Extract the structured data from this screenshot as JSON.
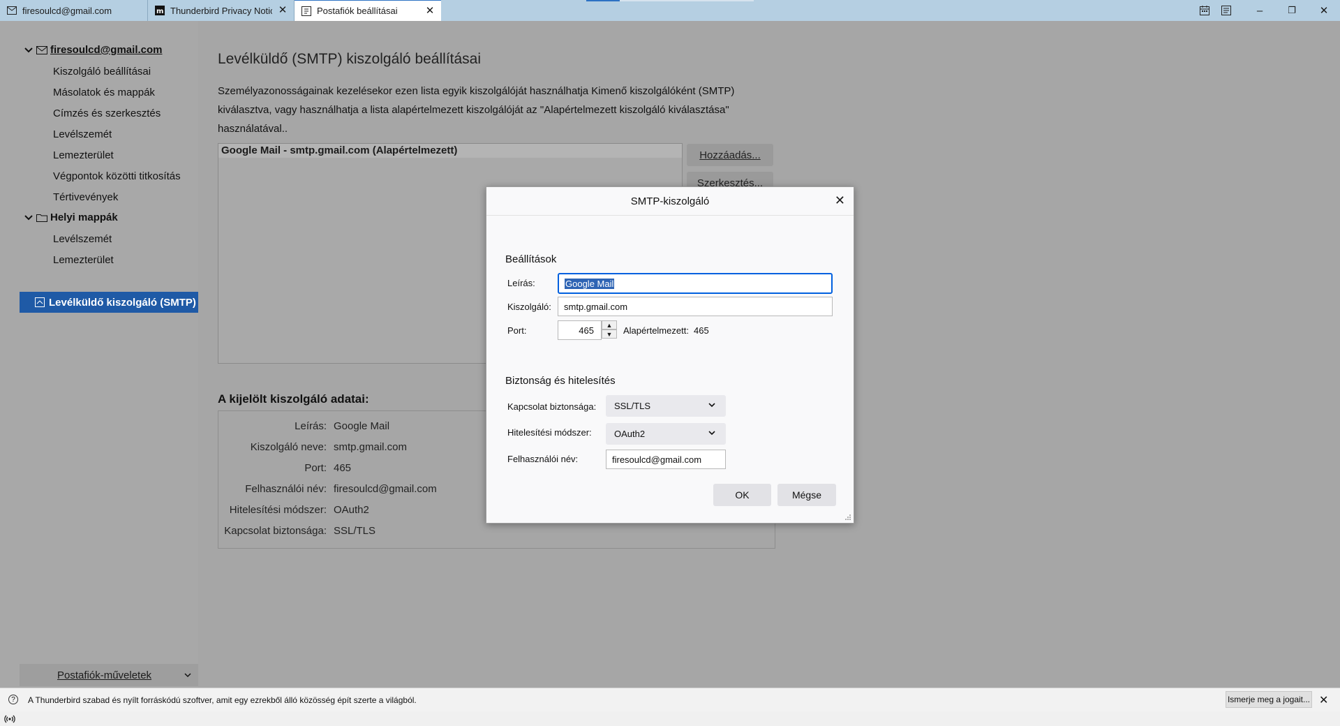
{
  "tabs": [
    {
      "label": "firesoulcd@gmail.com",
      "icon": "mail-icon"
    },
    {
      "label": "Thunderbird Privacy Notice",
      "icon": "mozilla-m-icon"
    },
    {
      "label": "Postafiók beállításai",
      "icon": "account-settings-icon"
    }
  ],
  "window_controls": {
    "minimize": "–",
    "maximize": "❐",
    "close": "✕"
  },
  "sidebar": {
    "account_name": "firesoulcd@gmail.com",
    "account_items": [
      "Kiszolgáló beállításai",
      "Másolatok és mappák",
      "Címzés és szerkesztés",
      "Levélszemét",
      "Lemezterület",
      "Végpontok közötti titkosítás",
      "Tértivevények"
    ],
    "local_name": "Helyi mappák",
    "local_items": [
      "Levélszemét",
      "Lemezterület"
    ],
    "smtp_item": "Levélküldő kiszolgáló (SMTP)",
    "account_actions": "Postafiók-műveletek"
  },
  "main": {
    "heading": "Levélküldő (SMTP) kiszolgáló beállításai",
    "description": "Személyazonosságainak kezelésekor ezen lista egyik kiszolgálóját használhatja Kimenő kiszolgálóként (SMTP) kiválasztva, vagy használhatja a lista alapértelmezett kiszolgálóját az \"Alapértelmezett kiszolgáló kiválasztása\" használatával..",
    "server_row": "Google Mail - smtp.gmail.com (Alapértelmezett)",
    "add_button": "Hozzáadás...",
    "edit_button": "Szerkesztés...",
    "details_title": "A kijelölt kiszolgáló adatai:",
    "details": [
      {
        "label": "Leírás:",
        "value": "Google Mail"
      },
      {
        "label": "Kiszolgáló neve:",
        "value": "smtp.gmail.com"
      },
      {
        "label": "Port:",
        "value": "465"
      },
      {
        "label": "Felhasználói név:",
        "value": "firesoulcd@gmail.com"
      },
      {
        "label": "Hitelesítési módszer:",
        "value": "OAuth2"
      },
      {
        "label": "Kapcsolat biztonsága:",
        "value": "SSL/TLS"
      }
    ]
  },
  "dialog": {
    "title": "SMTP-kiszolgáló",
    "settings_title": "Beállítások",
    "description_label": "Leírás:",
    "description_value": "Google Mail",
    "server_label": "Kiszolgáló:",
    "server_value": "smtp.gmail.com",
    "port_label": "Port:",
    "port_value": "465",
    "default_label": "Alapértelmezett:",
    "default_value": "465",
    "security_title": "Biztonság és hitelesítés",
    "conn_security_label": "Kapcsolat biztonsága:",
    "conn_security_value": "SSL/TLS",
    "auth_label": "Hitelesítési módszer:",
    "auth_value": "OAuth2",
    "username_label": "Felhasználói név:",
    "username_value": "firesoulcd@gmail.com",
    "ok": "OK",
    "cancel": "Mégse"
  },
  "notification": {
    "text": "A Thunderbird szabad és nyílt forráskódú szoftver, amit egy ezrekből álló közösség épít szerte a világból.",
    "button": "Ismerje meg a jogait...",
    "close": "✕"
  },
  "colors": {
    "selection": "#1f5aa6",
    "focus_ring": "#0060df",
    "tabbar": "#b5cfe2"
  }
}
